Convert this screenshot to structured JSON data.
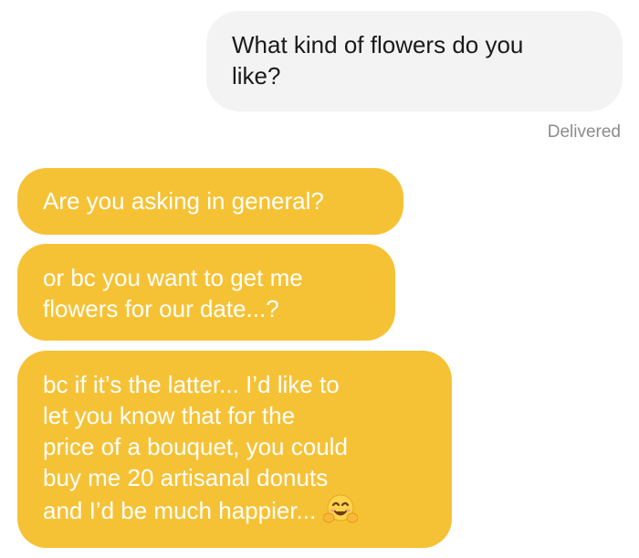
{
  "conversation": {
    "outgoing": {
      "text": "What kind of flowers do you\nlike?",
      "status": "Delivered"
    },
    "incoming": [
      {
        "text": "Are you asking in general?"
      },
      {
        "text": "or bc you want to get me\nflowers for our date...?"
      },
      {
        "text": "bc if it’s the latter... I’d like to\nlet you know that for the\nprice of a bouquet, you could\nbuy me 20 artisanal donuts\nand I’d be much happier...",
        "emoji": "hugging-face-emoji"
      }
    ]
  },
  "colors": {
    "incoming_bubble": "#f6c235",
    "outgoing_bubble": "#f3f3f3",
    "incoming_text": "#ffffff",
    "outgoing_text": "#1a1a1a",
    "status_text": "#8c8c8c"
  }
}
